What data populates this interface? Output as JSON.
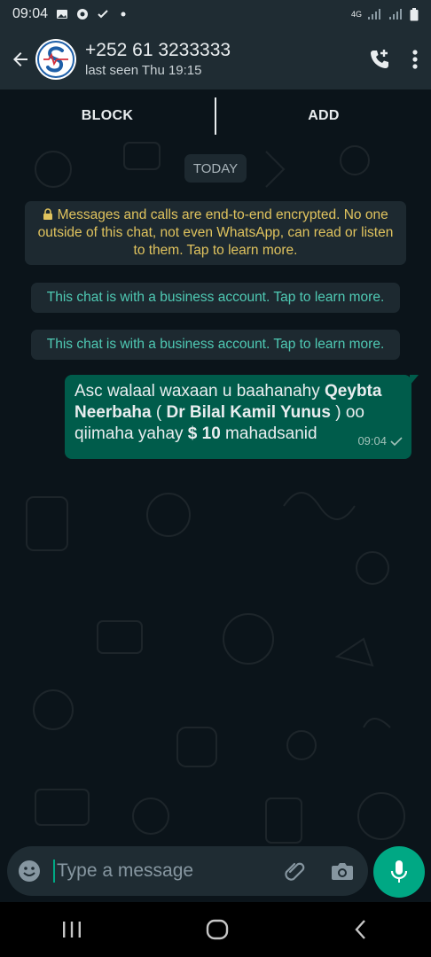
{
  "status": {
    "time": "09:04",
    "network": "4G"
  },
  "header": {
    "title": "+252 61 3233333",
    "subtitle": "last seen Thu 19:15"
  },
  "actions": {
    "block": "BLOCK",
    "add": "ADD"
  },
  "chat": {
    "date_chip": "TODAY",
    "encryption_notice": "Messages and calls are end-to-end encrypted. No one outside of this chat, not even WhatsApp, can read or listen to them. Tap to learn more.",
    "business_notices": [
      "This chat is with a business account. Tap to learn more.",
      "This chat is with a business account. Tap to learn more."
    ],
    "message": {
      "text_1": "Asc walaal waxaan u baahanahy ",
      "bold_1": "Qeybta Neerbaha",
      "text_2": " ( ",
      "bold_2": "Dr Bilal Kamil Yunus",
      "text_3": " ) oo qiimaha yahay ",
      "bold_3": "$ 10",
      "text_4": " mahadsanid",
      "time": "09:04"
    }
  },
  "composer": {
    "placeholder": "Type a message"
  },
  "colors": {
    "header_bg": "#1f2c33",
    "chat_bg": "#0b141a",
    "outgoing_bubble": "#005c4b",
    "accent": "#00a884",
    "notice_text": "#e0c35e",
    "business_text": "#4fcab4"
  },
  "icons": {
    "back": "arrow-left-icon",
    "call": "add-call-icon",
    "menu": "more-vert-icon",
    "emoji": "emoji-icon",
    "attach": "paperclip-icon",
    "camera": "camera-icon",
    "mic": "microphone-icon"
  }
}
